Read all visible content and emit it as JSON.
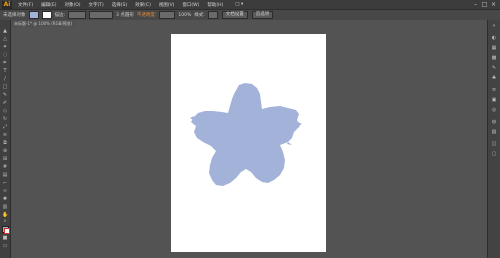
{
  "app": {
    "logo": "Ai"
  },
  "menubar": {
    "items": [
      "文件(F)",
      "编辑(E)",
      "对象(O)",
      "文字(T)",
      "选择(S)",
      "效果(C)",
      "视图(V)",
      "窗口(W)",
      "帮助(H)"
    ],
    "mode_button": "□ ▾"
  },
  "control_bar": {
    "label_noselection": "未选择对象",
    "stroke_label": "描边:",
    "stroke_value": "3 点圆形",
    "opacity_label": "不透明度:",
    "opacity_value": "100%",
    "style_label": "样式:",
    "doc_setup_button": "文档设置",
    "prefs_button": "首选项"
  },
  "document_tab": {
    "label": "未标题-1* @ 100% (RGB/预览)"
  },
  "colors": {
    "fill": "#a3b2d9",
    "stroke": "#d13333",
    "accent": "#e8893a"
  },
  "window_controls": {
    "minimize": "–",
    "maximize": "□",
    "close": "×"
  }
}
